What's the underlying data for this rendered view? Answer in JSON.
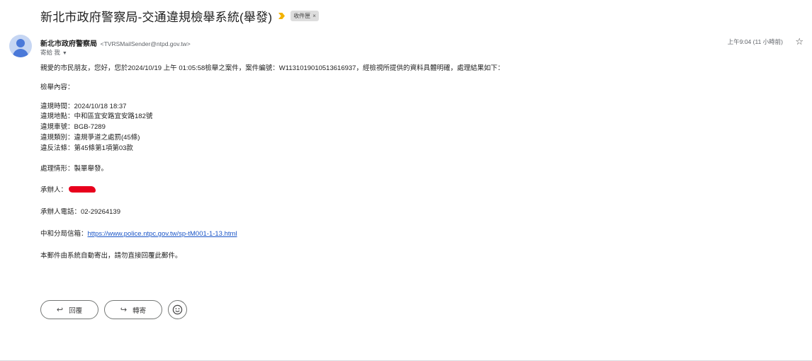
{
  "subject": "新北市政府警察局-交通違規檢舉系統(舉發)",
  "label": {
    "name": "收件匣",
    "remove": "×"
  },
  "colors": {
    "important_marker": "#f2b200",
    "link": "#1a55c7",
    "redaction": "#e8001c"
  },
  "sender": {
    "name": "新北市政府警察局",
    "email": "<TVRSMailSender@ntpd.gov.tw>",
    "to": "寄給 我",
    "caret": "▼"
  },
  "time": "上午9:04 (11 小時前)",
  "star_icon": "☆",
  "body": {
    "greeting": "親愛的市民朋友，您好，您於2024/10/19 上午 01:05:58檢舉之案件，案件編號：W1131019010513616937，經檢視所提供的資料具體明確，處理結果如下：",
    "content_heading": "檢舉內容：",
    "violation_time": "違規時間：2024/10/18 18:37",
    "violation_place": "違規地點：中和區宜安路宜安路182號",
    "violation_plate": "違規車號：BGB-7289",
    "violation_type": "違規類別：違規爭道之處罰(45條)",
    "violation_law": "違反法條：第45條第1項第03款",
    "handling": "處理情形：製單舉發。",
    "handler_label": "承辦人：",
    "handler_phone": "承辦人電話：02-29264139",
    "mailbox_label": "中和分局信箱：",
    "mailbox_url": "https://www.police.ntpc.gov.tw/sp-tM001-1-13.html",
    "footer": "本郵件由系統自動寄出，請勿直接回覆此郵件。"
  },
  "actions": {
    "reply_label": "回覆",
    "reply_icon": "↩",
    "forward_label": "轉寄",
    "forward_icon": "↪",
    "emoji_icon": "☺"
  }
}
